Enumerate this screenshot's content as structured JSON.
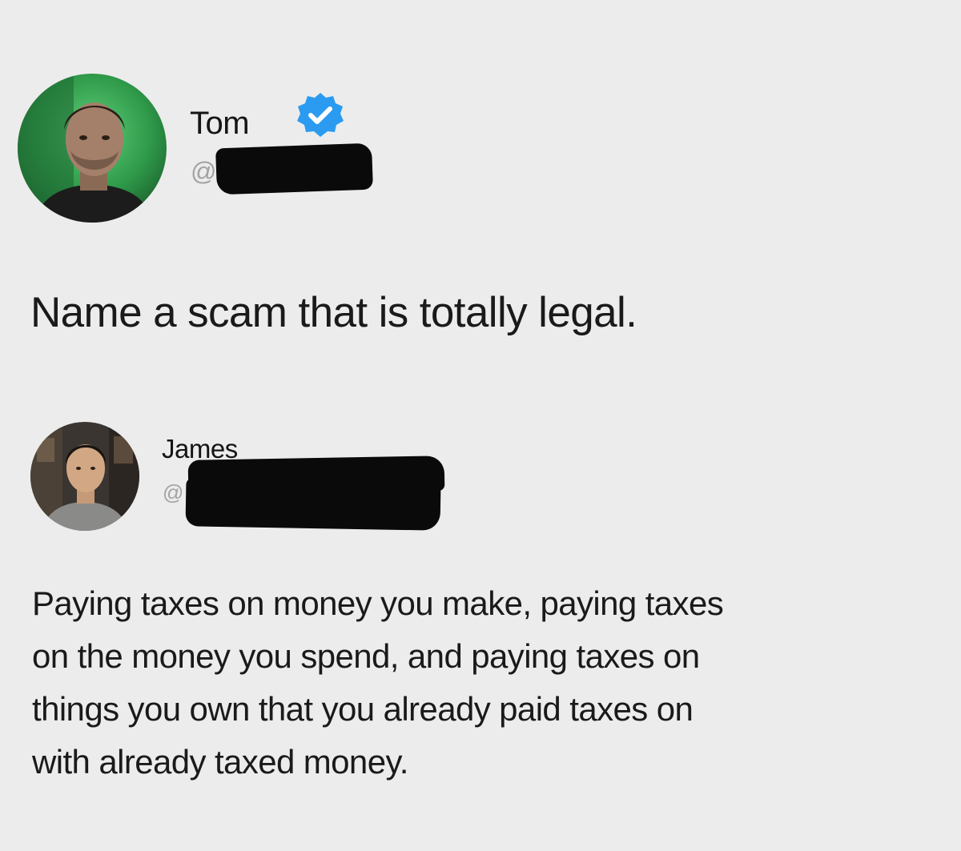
{
  "tweet": {
    "author": {
      "name": "Tom",
      "handle_prefix": "@",
      "verified": true,
      "avatar_icon": "person-avatar"
    },
    "text": "Name a scam that is totally legal."
  },
  "reply": {
    "author": {
      "name": "James",
      "handle_prefix": "@",
      "verified": false,
      "avatar_icon": "person-avatar"
    },
    "text_lines": [
      "Paying taxes on money you make, paying taxes",
      "on the money you spend, and paying taxes on",
      "things you own that you already paid taxes on",
      "with already taxed money."
    ]
  },
  "colors": {
    "background": "#ececec",
    "verified_badge": "#2a9bf0",
    "redaction": "#0a0a0a",
    "handle_text": "#a3a3a3"
  }
}
